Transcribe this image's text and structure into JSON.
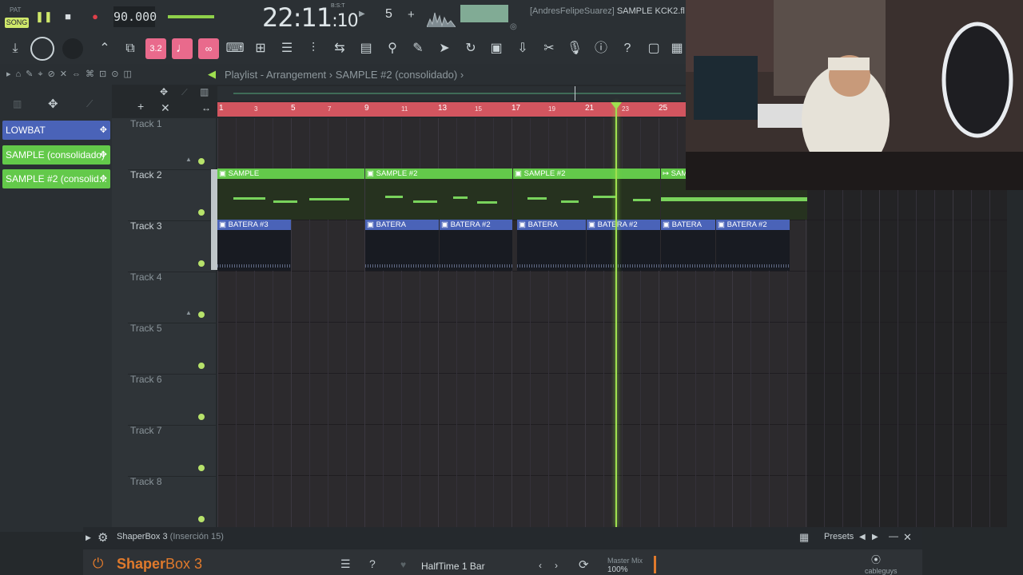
{
  "transport": {
    "pat_label": "PAT",
    "song_label": "SONG",
    "tempo": "90.000",
    "clock_main": "22:11",
    "clock_sub": "10",
    "clock_unit": "B:S:T",
    "pattern_number": "5",
    "project_user": "[AndresFelipeSuarez]",
    "project_file": "SAMPLE KCK2.fl"
  },
  "playlist": {
    "title": "Playlist - Arrangement",
    "separator": "›",
    "current_clip": "SAMPLE #2 (consolidado)",
    "ruler": [
      "1",
      "3",
      "5",
      "7",
      "9",
      "11",
      "13",
      "15",
      "17",
      "19",
      "21",
      "23",
      "25"
    ],
    "tracks": [
      {
        "name": "Track 1"
      },
      {
        "name": "Track 2"
      },
      {
        "name": "Track 3"
      },
      {
        "name": "Track 4"
      },
      {
        "name": "Track 5"
      },
      {
        "name": "Track 6"
      },
      {
        "name": "Track 7"
      },
      {
        "name": "Track 8"
      }
    ],
    "clips_track2": [
      "SAMPLE",
      "SAMPLE #2",
      "SAMPLE #2",
      "SAM"
    ],
    "clips_track3": [
      "BATERA #3",
      "BATERA",
      "BATERA #2",
      "BATERA",
      "BATERA #2",
      "BATERA",
      "BATERA #2"
    ]
  },
  "clip_list": [
    {
      "label": "LOWBAT",
      "color": "#4a63b8"
    },
    {
      "label": "SAMPLE (consolidado)",
      "color": "#63c94a"
    },
    {
      "label": "SAMPLE #2 (consolid...",
      "color": "#63c94a"
    }
  ],
  "plugin": {
    "name": "ShaperBox 3",
    "slot": "(Inserción 15)",
    "presets_label": "Presets",
    "logo_main": "Shaper",
    "logo_rest": "Box 3",
    "preset_name": "HalfTime 1 Bar",
    "master_label": "Master Mix",
    "master_value": "100%",
    "vendor": "cableguys"
  },
  "colors": {
    "accent_pink": "#e96a8c",
    "clip_green": "#63c94a",
    "clip_blue": "#4a63b8",
    "ruler_red": "#d2555f",
    "playhead": "#9fe04f"
  }
}
